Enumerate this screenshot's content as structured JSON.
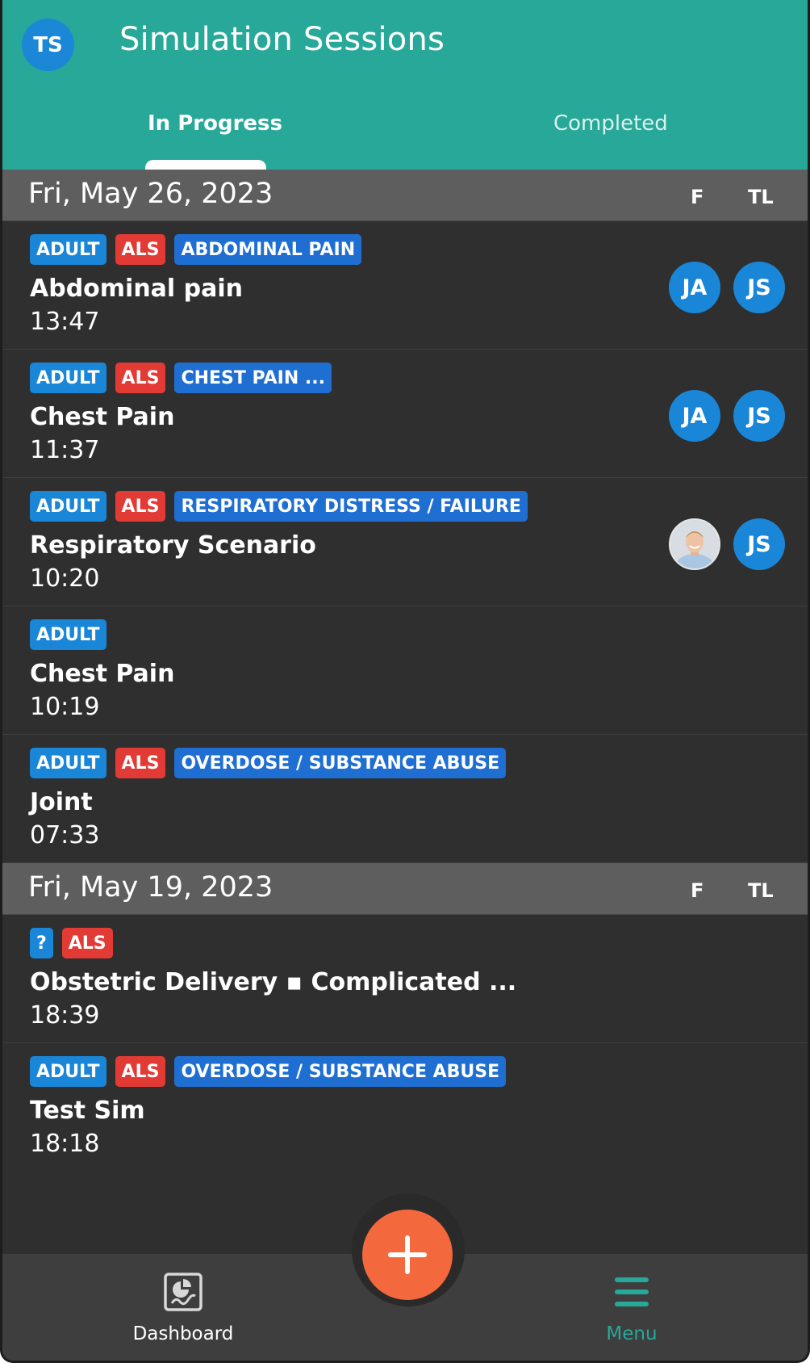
{
  "header": {
    "user_initials": "TS",
    "title": "Simulation Sessions",
    "tabs": [
      {
        "label": "In Progress",
        "active": true
      },
      {
        "label": "Completed",
        "active": false
      }
    ]
  },
  "columns": {
    "f": "F",
    "tl": "TL"
  },
  "groups": [
    {
      "date": "Fri, May 26, 2023",
      "sessions": [
        {
          "tags": [
            {
              "text": "ADULT",
              "color": "blue"
            },
            {
              "text": "ALS",
              "color": "red"
            },
            {
              "text": "ABDOMINAL PAIN",
              "color": "dblue"
            }
          ],
          "title": "Abdominal pain",
          "time": "13:47",
          "f": "JA",
          "tl": "JS"
        },
        {
          "tags": [
            {
              "text": "ADULT",
              "color": "blue"
            },
            {
              "text": "ALS",
              "color": "red"
            },
            {
              "text": "CHEST PAIN ...",
              "color": "dblue"
            }
          ],
          "title": "Chest Pain",
          "time": "11:37",
          "f": "JA",
          "tl": "JS"
        },
        {
          "tags": [
            {
              "text": "ADULT",
              "color": "blue"
            },
            {
              "text": "ALS",
              "color": "red"
            },
            {
              "text": "RESPIRATORY DISTRESS / FAILURE",
              "color": "dblue"
            }
          ],
          "title": "Respiratory Scenario",
          "time": "10:20",
          "f": "",
          "tl": "JS"
        },
        {
          "tags": [
            {
              "text": "ADULT",
              "color": "blue"
            }
          ],
          "title": "Chest Pain",
          "time": "10:19",
          "f": "",
          "tl": ""
        },
        {
          "tags": [
            {
              "text": "ADULT",
              "color": "blue"
            },
            {
              "text": "ALS",
              "color": "red"
            },
            {
              "text": "OVERDOSE / SUBSTANCE ABUSE",
              "color": "dblue"
            }
          ],
          "title": "Joint",
          "time": "07:33",
          "f": "",
          "tl": ""
        }
      ]
    },
    {
      "date": "Fri, May 19, 2023",
      "sessions": [
        {
          "tags": [
            {
              "text": "?",
              "color": "blue"
            },
            {
              "text": "ALS",
              "color": "red"
            }
          ],
          "title": "Obstetric Delivery ▪ Complicated ...",
          "time": "18:39",
          "f": "",
          "tl": ""
        },
        {
          "tags": [
            {
              "text": "ADULT",
              "color": "blue"
            },
            {
              "text": "ALS",
              "color": "red"
            },
            {
              "text": "OVERDOSE / SUBSTANCE ABUSE",
              "color": "dblue"
            }
          ],
          "title": "Test Sim",
          "time": "18:18",
          "f": "",
          "tl": ""
        }
      ]
    }
  ],
  "bottom_nav": {
    "dashboard_label": "Dashboard",
    "menu_label": "Menu",
    "add_icon": "plus-icon",
    "dashboard_icon": "dashboard-chart-icon",
    "menu_icon": "hamburger-icon"
  },
  "colors": {
    "header": "#27a898",
    "background": "#2f2f2f",
    "tag_blue": "#1a86d8",
    "tag_red": "#e23b36",
    "fab": "#f4683d"
  }
}
